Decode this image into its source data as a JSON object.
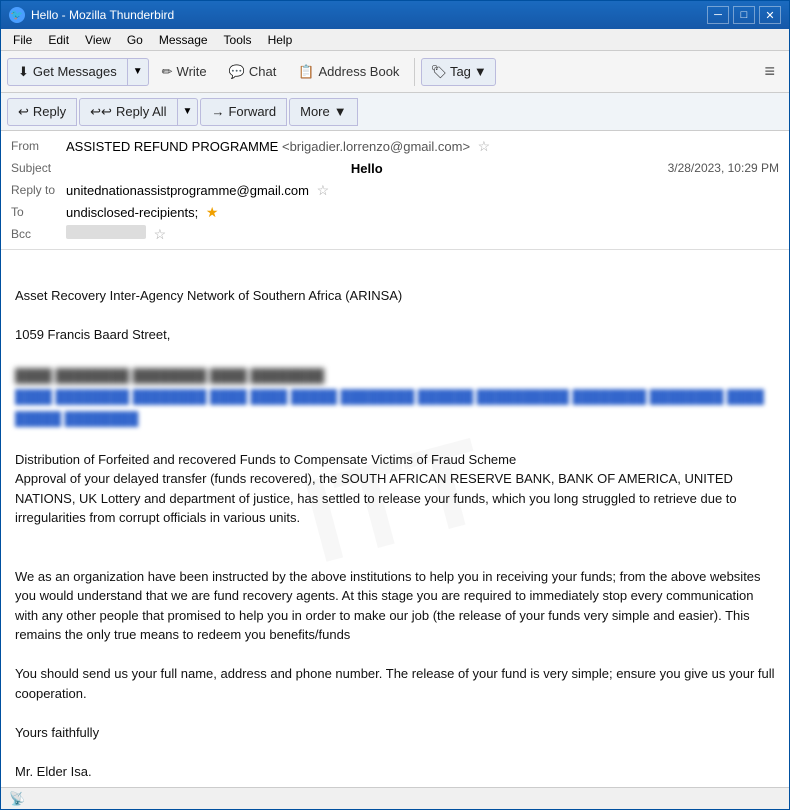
{
  "window": {
    "title": "Hello - Mozilla Thunderbird",
    "icon": "🐦"
  },
  "titlebar": {
    "minimize_label": "─",
    "maximize_label": "□",
    "close_label": "✕"
  },
  "menubar": {
    "items": [
      {
        "label": "File"
      },
      {
        "label": "Edit"
      },
      {
        "label": "View"
      },
      {
        "label": "Go"
      },
      {
        "label": "Message"
      },
      {
        "label": "Tools"
      },
      {
        "label": "Help"
      }
    ]
  },
  "toolbar": {
    "get_messages": "Get Messages",
    "write": "Write",
    "chat": "Chat",
    "address_book": "Address Book",
    "tag": "Tag",
    "hamburger": "≡"
  },
  "action_bar": {
    "reply": "Reply",
    "reply_all": "Reply All",
    "forward": "Forward",
    "more": "More"
  },
  "email": {
    "from_label": "From",
    "from_name": "ASSISTED REFUND PROGRAMME",
    "from_email": "<brigadier.lorrenzo@gmail.com>",
    "subject_label": "Subject",
    "subject": "Hello",
    "date": "3/28/2023, 10:29 PM",
    "reply_to_label": "Reply to",
    "reply_to": "unitednationassistprogramme@gmail.com",
    "to_label": "To",
    "to": "undisclosed-recipients;",
    "bcc_label": "Bcc",
    "bcc": "",
    "body_lines": [
      "",
      "Asset Recovery Inter-Agency Network of Southern Africa (ARINSA)",
      "",
      "1059 Francis Baard Street,",
      "",
      "",
      "",
      "",
      "",
      "Distribution of Forfeited and recovered Funds to Compensate Victims of Fraud Scheme",
      "Approval of your delayed transfer (funds recovered), the SOUTH AFRICAN RESERVE BANK, BANK OF AMERICA, UNITED NATIONS, UK Lottery  and department of justice, has settled to release your funds, which you long struggled to retrieve due to irregularities from corrupt officials in various units.",
      "",
      "",
      "We as an organization have been instructed by the above institutions to help you in receiving your funds; from the above websites you would understand that we are fund recovery agents. At this stage you are required to immediately stop every communication with any other people that promised to help you in order to make our job (the release of your funds very simple and easier). This remains the only true means to redeem you benefits/funds",
      "",
      "You should send us your full name, address and phone number. The release of your fund is very simple; ensure you give us your full cooperation.",
      "",
      " Yours faithfully",
      "",
      "Mr. Elder Isa."
    ]
  },
  "status_bar": {
    "icon": "📡",
    "text": ""
  },
  "icons": {
    "get_messages_icon": "⬇",
    "write_icon": "✏",
    "chat_icon": "💬",
    "address_book_icon": "📋",
    "tag_icon": "🏷",
    "reply_icon": "↩",
    "reply_all_icon": "↩↩",
    "forward_icon": "→",
    "dropdown_icon": "▼",
    "star_icon": "☆",
    "star_filled_icon": "★"
  },
  "blurred_texts": {
    "line1": "████ ████████ ████████ ████",
    "line2": "████ ████████ ████████ ████ ████ █████ ████████ ██████ ██████████ ████████"
  }
}
